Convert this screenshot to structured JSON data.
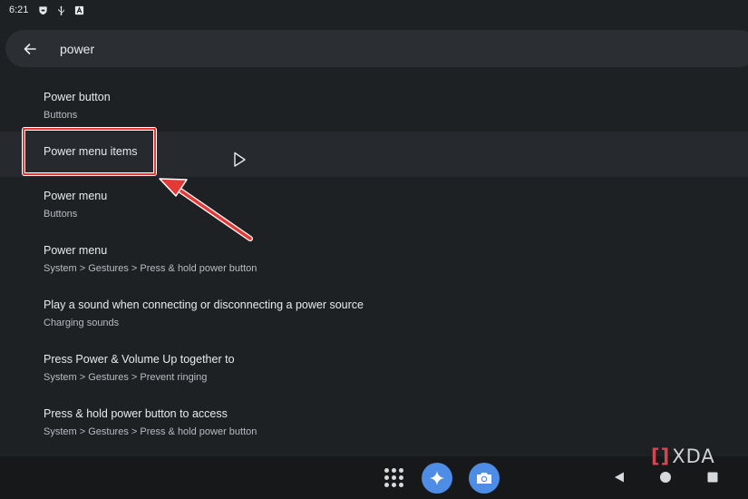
{
  "status_bar": {
    "time": "6:21",
    "icons": [
      "shield-icon",
      "usb-icon",
      "a-box-icon"
    ]
  },
  "search": {
    "value": "power",
    "back_icon": "arrow-left-icon"
  },
  "results": [
    {
      "title": "Power button",
      "subtitle": "Buttons"
    },
    {
      "title": "Power menu items",
      "subtitle": ""
    },
    {
      "title": "Power menu",
      "subtitle": "Buttons"
    },
    {
      "title": "Power menu",
      "subtitle": "System > Gestures > Press & hold power button"
    },
    {
      "title": "Play a sound when connecting or disconnecting a power source",
      "subtitle": "Charging sounds"
    },
    {
      "title": "Press Power & Volume Up together to",
      "subtitle": "System > Gestures > Prevent ringing"
    },
    {
      "title": "Press & hold power button to access",
      "subtitle": "System > Gestures > Press & hold power button"
    }
  ],
  "annotation": {
    "highlight_color": "#e53935",
    "highlighted_item": "Power menu items"
  },
  "nav_bar": {
    "icons": [
      "app-drawer-icon",
      "assistant-icon",
      "camera-icon",
      "back-triangle-icon",
      "home-circle-icon",
      "recents-square-icon"
    ],
    "accent": "#4d8de6"
  },
  "watermark": {
    "bracket": "[]",
    "text": "XDA"
  }
}
